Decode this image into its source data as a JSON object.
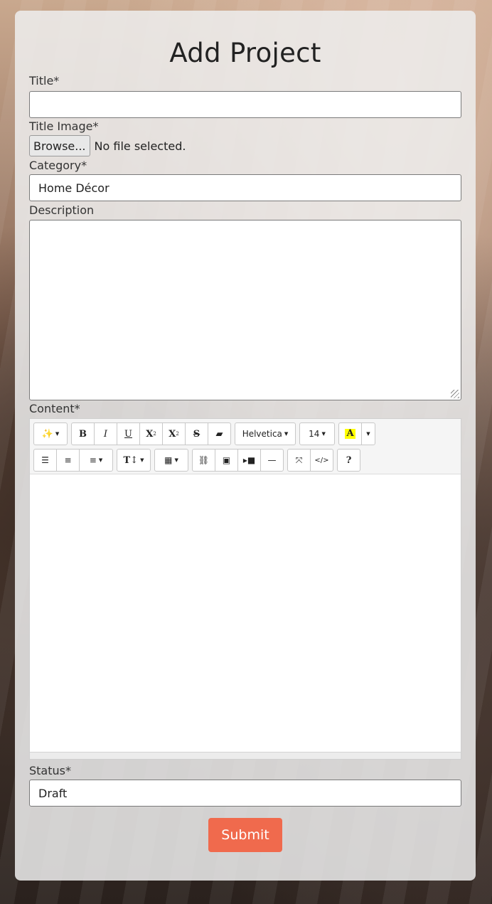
{
  "form": {
    "title": "Add Project",
    "title_label": "Title*",
    "title_value": "",
    "image_label": "Title Image*",
    "browse_label": "Browse...",
    "file_status": "No file selected.",
    "category_label": "Category*",
    "category_value": "Home Décor",
    "description_label": "Description",
    "content_label": "Content*",
    "status_label": "Status*",
    "status_value": "Draft",
    "submit_label": "Submit"
  },
  "toolbar": {
    "font_name": "Helvetica",
    "font_size": "14",
    "icons": [
      "magic-icon",
      "bold-icon",
      "italic-icon",
      "underline-icon",
      "superscript-icon",
      "subscript-icon",
      "strikethrough-icon",
      "eraser-icon",
      "unordered-list-icon",
      "ordered-list-icon",
      "align-icon",
      "line-height-icon",
      "table-icon",
      "link-icon",
      "image-icon",
      "video-icon",
      "horizontal-rule-icon",
      "fullscreen-icon",
      "code-view-icon",
      "help-icon"
    ],
    "highlight_color": "#ffff00"
  },
  "colors": {
    "accent": "#f06a4d"
  }
}
